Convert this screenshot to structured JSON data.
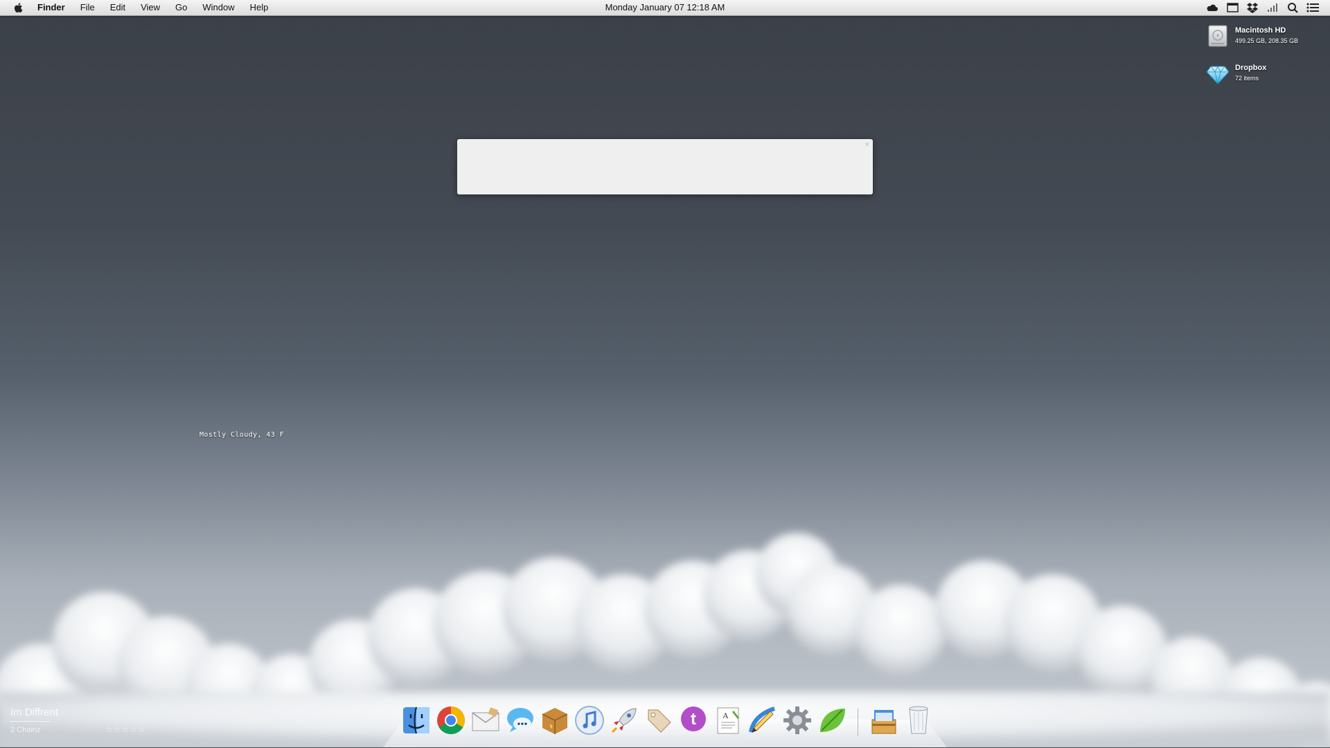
{
  "menubar": {
    "apple_icon": "apple-logo-icon",
    "menus": [
      "Finder",
      "File",
      "Edit",
      "View",
      "Go",
      "Window",
      "Help"
    ],
    "clock": "Monday January 07 12:18 AM",
    "status_icons": [
      "cloud-icon",
      "window-icon",
      "dropbox-icon",
      "signal-bars-icon",
      "spotlight-icon",
      "notification-center-icon"
    ]
  },
  "desktop": {
    "drives": [
      {
        "name": "Macintosh HD",
        "info": "499.25 GB, 208.35 GB",
        "icon": "hard-drive-icon"
      },
      {
        "name": "Dropbox",
        "info": "72 items",
        "icon": "dropbox-diamond-icon"
      }
    ]
  },
  "panel": {
    "close_glyph": "×"
  },
  "weather": {
    "text": "Mostly Cloudy, 43 F"
  },
  "now_playing": {
    "song": "Im Diffrent",
    "artist": "2 Chainz",
    "rating": "☆☆☆☆☆"
  },
  "dock": {
    "apps": [
      "finder-icon",
      "chrome-icon",
      "mail-icon",
      "messages-icon",
      "package-icon",
      "itunes-icon",
      "launchpad-rocket-icon",
      "price-tag-icon",
      "twitter-icon",
      "textedit-icon",
      "pencil-app-icon",
      "system-preferences-icon",
      "leaf-app-icon"
    ],
    "right": [
      "downloads-stack-icon",
      "trash-icon"
    ]
  },
  "colors": {
    "menubar": "#e8e8e8",
    "panel": "#efefef",
    "sky_top": "#3b4048",
    "sky_bottom": "#c7ccd2"
  }
}
